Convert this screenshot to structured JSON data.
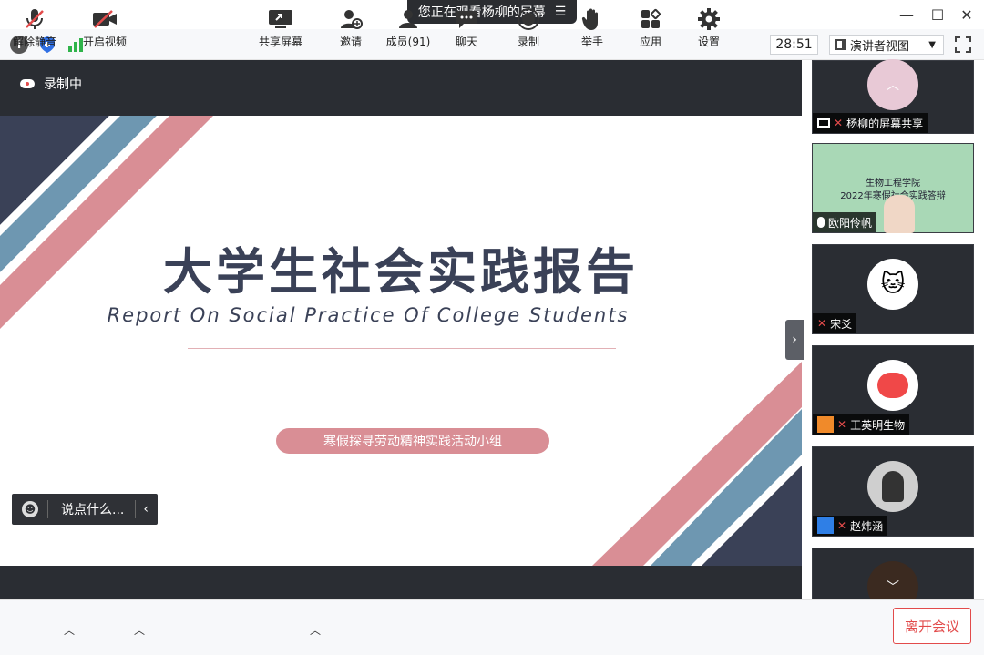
{
  "banner": {
    "text": "您正在观看杨柳的屏幕",
    "menu_icon": "list-icon"
  },
  "window_controls": {
    "minimize": "—",
    "maximize": "☐",
    "close": "✕"
  },
  "toolbar": {
    "timer": "28:51",
    "view_label": "演讲者视图"
  },
  "stage": {
    "recording_label": "录制中"
  },
  "slide": {
    "title": "大学生社会实践报告",
    "subtitle": "Report On Social Practice Of College Students",
    "pill": "寒假探寻劳动精神实践活动小组"
  },
  "chat": {
    "placeholder": "说点什么..."
  },
  "participants": [
    {
      "name": "杨柳的屏幕共享"
    },
    {
      "name": "欧阳伶帆",
      "video_text_line1": "生物工程学院",
      "video_text_line2": "2022年寒假社会实践答辩"
    },
    {
      "name": "宋爻"
    },
    {
      "name": "王英明生物"
    },
    {
      "name": "赵炜涵"
    },
    {
      "name": ""
    }
  ],
  "bottom": {
    "unmute": "解除静音",
    "video": "开启视频",
    "share": "共享屏幕",
    "invite": "邀请",
    "members": "成员(91)",
    "chat": "聊天",
    "record": "录制",
    "raise_hand": "举手",
    "apps": "应用",
    "settings": "设置",
    "leave": "离开会议"
  },
  "colors": {
    "accent_red": "#e24b4b",
    "slide_navy": "#3a4157",
    "slide_pink": "#d98e95",
    "slide_blue": "#6e97b1"
  }
}
